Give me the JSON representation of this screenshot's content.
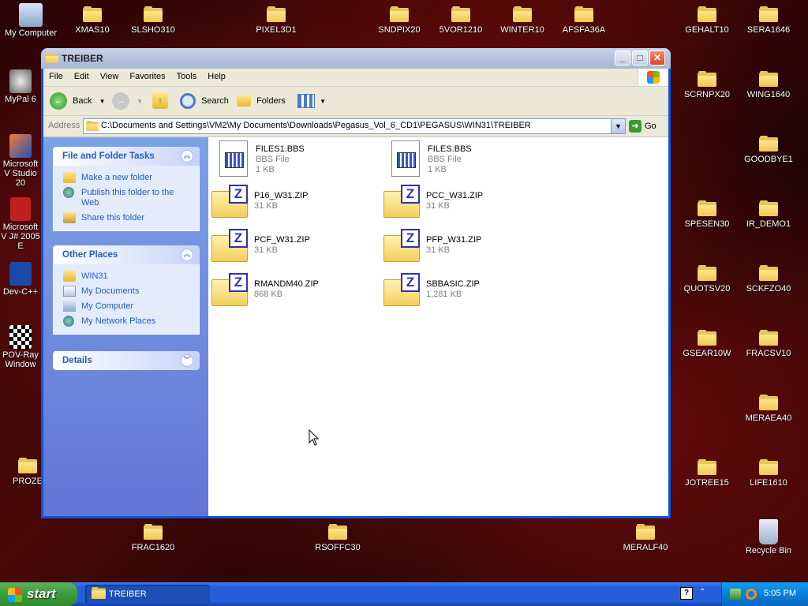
{
  "desktop": {
    "icons": [
      {
        "label": "My Computer"
      },
      {
        "label": "XMAS10"
      },
      {
        "label": "SLSHO310"
      },
      {
        "label": "PIXEL3D1"
      },
      {
        "label": "SNDPIX20"
      },
      {
        "label": "5VOR1210"
      },
      {
        "label": "WINTER10"
      },
      {
        "label": "AFSFA36A"
      },
      {
        "label": "GEHALT10"
      },
      {
        "label": "SERA1646"
      },
      {
        "label": "MyPal 6"
      },
      {
        "label": "SCRNPX20"
      },
      {
        "label": "WING1640"
      },
      {
        "label": "Microsoft V Studio 20"
      },
      {
        "label": "GOODBYE1"
      },
      {
        "label": "Microsoft V J# 2005 E"
      },
      {
        "label": "SPESEN30"
      },
      {
        "label": "IR_DEMO1"
      },
      {
        "label": "Dev-C++"
      },
      {
        "label": "QUOTSV20"
      },
      {
        "label": "SCKFZO40"
      },
      {
        "label": "POV-Ray Window"
      },
      {
        "label": "GSEAR10W"
      },
      {
        "label": "FRACSV10"
      },
      {
        "label": "MERAEA40"
      },
      {
        "label": "PROZE"
      },
      {
        "label": "JOTREE15"
      },
      {
        "label": "LIFE1610"
      },
      {
        "label": "FRAC1620"
      },
      {
        "label": "RSOFFC30"
      },
      {
        "label": "MERALF40"
      },
      {
        "label": "Recycle Bin"
      }
    ]
  },
  "window": {
    "title": "TREIBER",
    "menu": [
      "File",
      "Edit",
      "View",
      "Favorites",
      "Tools",
      "Help"
    ],
    "toolbar": {
      "back": "Back",
      "search": "Search",
      "folders": "Folders"
    },
    "address": {
      "label": "Address",
      "path": "C:\\Documents and Settings\\VM2\\My Documents\\Downloads\\Pegasus_Vol_6_CD1\\PEGASUS\\WIN31\\TREIBER",
      "go": "Go"
    },
    "tasks": {
      "title": "File and Folder Tasks",
      "items": [
        "Make a new folder",
        "Publish this folder to the Web",
        "Share this folder"
      ]
    },
    "other_places": {
      "title": "Other Places",
      "items": [
        "WIN31",
        "My Documents",
        "My Computer",
        "My Network Places"
      ]
    },
    "details": {
      "title": "Details"
    },
    "files": [
      {
        "name": "FILES1.BBS",
        "type": "BBS File",
        "size": "1 KB"
      },
      {
        "name": "FILES.BBS",
        "type": "BBS File",
        "size": "1 KB"
      },
      {
        "name": "P16_W31.ZIP",
        "size": "31 KB"
      },
      {
        "name": "PCC_W31.ZIP",
        "size": "31 KB"
      },
      {
        "name": "PCF_W31.ZIP",
        "size": "31 KB"
      },
      {
        "name": "PFP_W31.ZIP",
        "size": "31 KB"
      },
      {
        "name": "RMANDM40.ZIP",
        "size": "868 KB"
      },
      {
        "name": "SBBASIC.ZIP",
        "size": "1,281 KB"
      }
    ]
  },
  "taskbar": {
    "start": "start",
    "task": "TREIBER",
    "help": "?",
    "clock": "5:05 PM"
  }
}
